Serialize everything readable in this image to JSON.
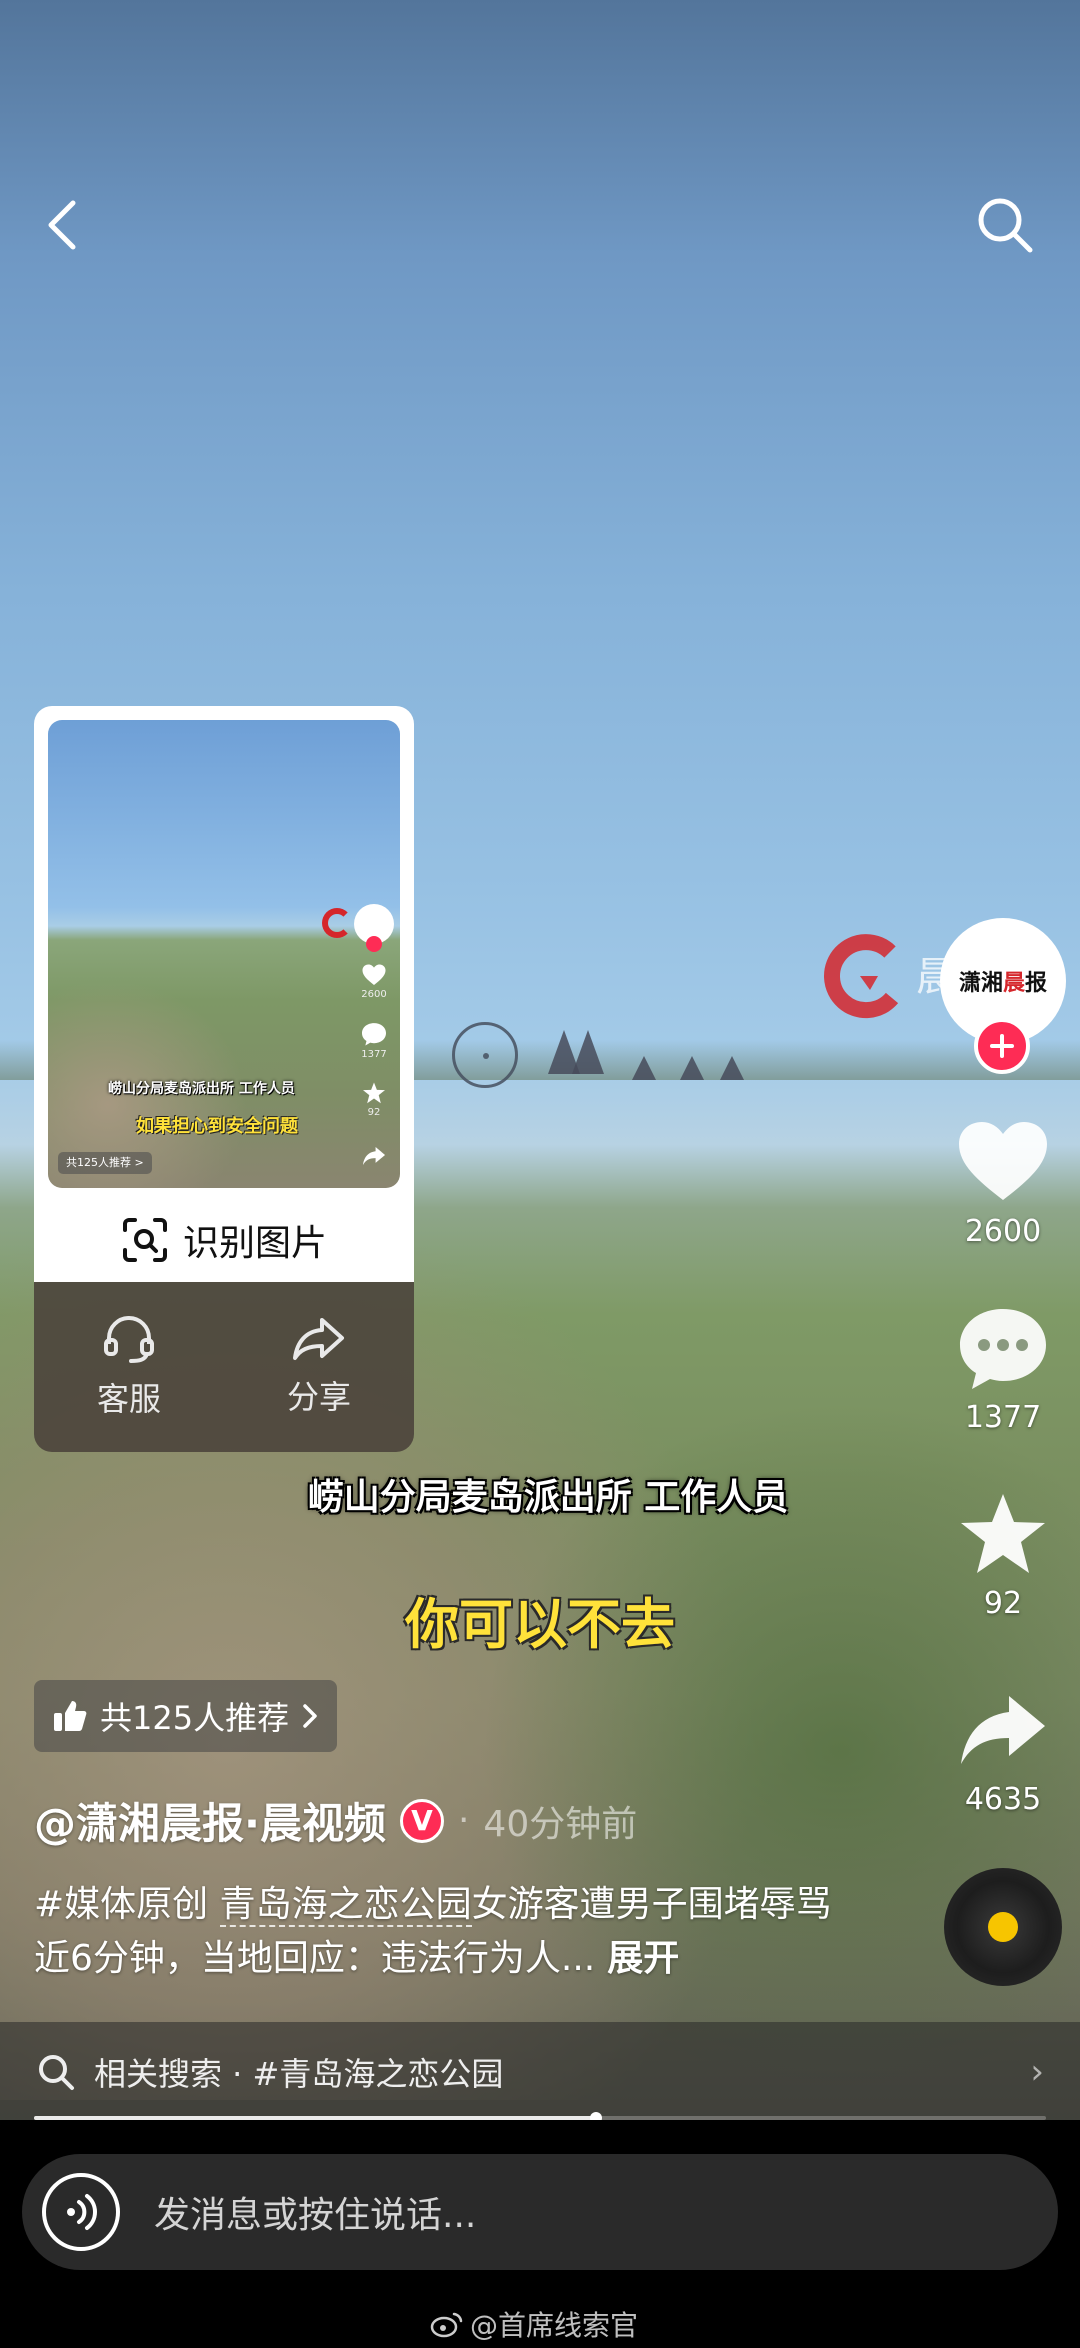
{
  "subtitles": {
    "line1": "崂山分局麦岛派出所 工作人员",
    "line2": "你可以不去"
  },
  "watermark": {
    "text": "晨"
  },
  "account": {
    "avatar_text_a": "潇湘",
    "avatar_text_b": "晨",
    "avatar_text_c": "报"
  },
  "actions": {
    "likes": "2600",
    "comments": "1377",
    "favorites": "92",
    "shares": "4635"
  },
  "popup": {
    "recognize_label": "识别图片",
    "service_label": "客服",
    "share_label": "分享",
    "thumb": {
      "sub1": "崂山分局麦岛派出所 工作人员",
      "sub2": "如果担心到安全问题",
      "pill": "共125人推荐 >",
      "likes": "2600",
      "comments": "1377",
      "favorites": "92"
    }
  },
  "recommend": {
    "label": "共125人推荐"
  },
  "post": {
    "author": "@潇湘晨报·晨视频",
    "verified": "V",
    "dot": "·",
    "time": "40分钟前",
    "caption_tag": "#媒体原创 ",
    "caption_link": "青岛海之恋公园",
    "caption_rest": "女游客遭男子围堵辱骂近6分钟，当地回应：违法行为人...",
    "expand": "展开"
  },
  "related_search": {
    "label": "相关搜索 · #青岛海之恋公园"
  },
  "progress": {
    "fraction": 0.555
  },
  "input": {
    "placeholder": "发消息或按住说话..."
  },
  "footer": {
    "watermark": "@首席线索官"
  },
  "colors": {
    "accent": "#fe2c55",
    "subtitle_yellow": "#ffe23a",
    "logo_red": "#d5262b"
  }
}
